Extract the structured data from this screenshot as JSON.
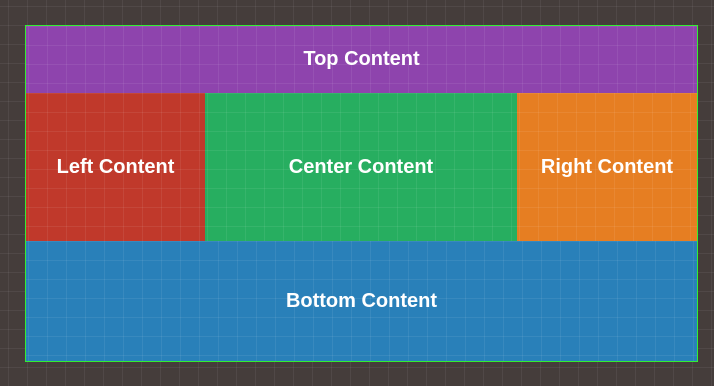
{
  "layout": {
    "top": {
      "label": "Top Content",
      "color": "#8e44ad"
    },
    "left": {
      "label": "Left Content",
      "color": "#c0392b"
    },
    "center": {
      "label": "Center Content",
      "color": "#27ae60"
    },
    "right": {
      "label": "Right Content",
      "color": "#e67e22"
    },
    "bottom": {
      "label": "Bottom Content",
      "color": "#2980b9"
    }
  },
  "colors": {
    "background": "#453d3b",
    "frame_border": "#33ee33",
    "text": "#ffffff"
  }
}
